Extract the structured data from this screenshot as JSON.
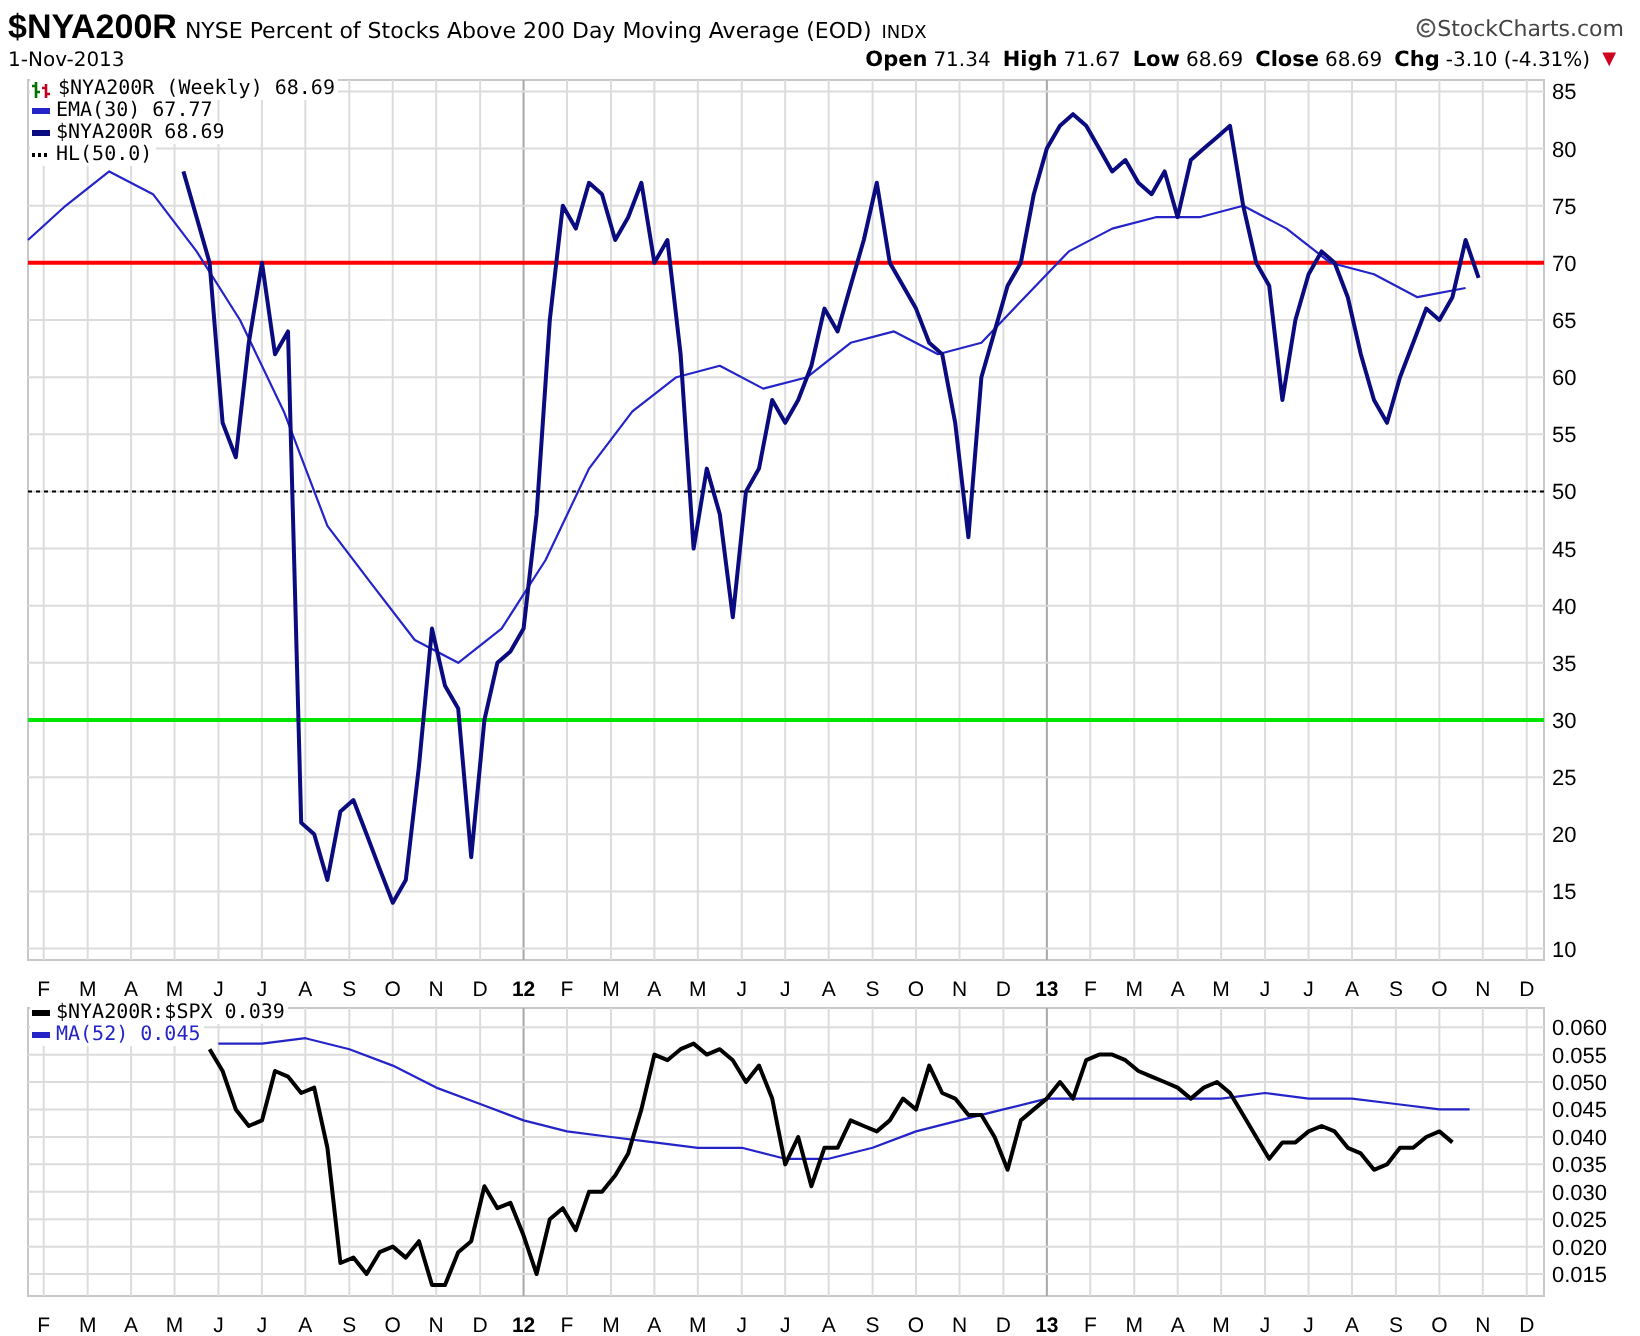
{
  "header": {
    "symbol": "$NYA200R",
    "title": "NYSE Percent of Stocks Above 200 Day Moving Average (EOD)",
    "exchange": "INDX",
    "brand": "StockCharts.com",
    "date": "1-Nov-2013",
    "quote": [
      {
        "label": "Open",
        "value": "71.34"
      },
      {
        "label": "High",
        "value": "71.67"
      },
      {
        "label": "Low",
        "value": "68.69"
      },
      {
        "label": "Close",
        "value": "68.69"
      },
      {
        "label": "Chg",
        "value": "-3.10 (-4.31%)"
      }
    ],
    "change_arrow": "▼"
  },
  "main_chart": {
    "legend": [
      {
        "kind": "bars",
        "text": "$NYA200R (Weekly) 68.69"
      },
      {
        "kind": "line",
        "text": "EMA(30) 67.77",
        "color": "#2424c8"
      },
      {
        "kind": "line",
        "text": "$NYA200R  68.69",
        "color": "#0b0b80"
      },
      {
        "kind": "dotted",
        "text": "HL(50.0)",
        "color": "#000000"
      }
    ],
    "chart_data": {
      "type": "line",
      "ylim": [
        9,
        86
      ],
      "xlim": [
        11.053,
        13.95
      ],
      "yticks": [
        10,
        15,
        20,
        25,
        30,
        35,
        40,
        45,
        50,
        55,
        60,
        65,
        70,
        75,
        80,
        85
      ],
      "xticks": [
        {
          "value": 11.083,
          "label": "F"
        },
        {
          "value": 11.167,
          "label": "M"
        },
        {
          "value": 11.25,
          "label": "A"
        },
        {
          "value": 11.333,
          "label": "M"
        },
        {
          "value": 11.417,
          "label": "J"
        },
        {
          "value": 11.5,
          "label": "J"
        },
        {
          "value": 11.583,
          "label": "A"
        },
        {
          "value": 11.667,
          "label": "S"
        },
        {
          "value": 11.75,
          "label": "O"
        },
        {
          "value": 11.833,
          "label": "N"
        },
        {
          "value": 11.917,
          "label": "D"
        },
        {
          "value": 12,
          "label": "12"
        },
        {
          "value": 12.083,
          "label": "F"
        },
        {
          "value": 12.167,
          "label": "M"
        },
        {
          "value": 12.25,
          "label": "A"
        },
        {
          "value": 12.333,
          "label": "M"
        },
        {
          "value": 12.417,
          "label": "J"
        },
        {
          "value": 12.5,
          "label": "J"
        },
        {
          "value": 12.583,
          "label": "A"
        },
        {
          "value": 12.667,
          "label": "S"
        },
        {
          "value": 12.75,
          "label": "O"
        },
        {
          "value": 12.833,
          "label": "N"
        },
        {
          "value": 12.917,
          "label": "D"
        },
        {
          "value": 13,
          "label": "13"
        },
        {
          "value": 13.083,
          "label": "F"
        },
        {
          "value": 13.167,
          "label": "M"
        },
        {
          "value": 13.25,
          "label": "A"
        },
        {
          "value": 13.333,
          "label": "M"
        },
        {
          "value": 13.417,
          "label": "J"
        },
        {
          "value": 13.5,
          "label": "J"
        },
        {
          "value": 13.583,
          "label": "A"
        },
        {
          "value": 13.667,
          "label": "S"
        },
        {
          "value": 13.75,
          "label": "O"
        },
        {
          "value": 13.833,
          "label": "N"
        },
        {
          "value": 13.917,
          "label": "D"
        }
      ],
      "series": [
        {
          "line_style": "solid",
          "color": "#ff0000",
          "x": [
            11.053,
            13.95
          ],
          "values": [
            70,
            70
          ]
        },
        {
          "line_style": "dotted",
          "color": "#000000",
          "x": [
            11.053,
            13.95
          ],
          "values": [
            50,
            50
          ]
        },
        {
          "line_style": "solid",
          "color": "#00e600",
          "x": [
            11.053,
            13.95
          ],
          "values": [
            30,
            30
          ]
        },
        {
          "line_style": "solid",
          "color": "#2424c8",
          "x": [
            11.053,
            11.125,
            11.208,
            11.292,
            11.375,
            11.458,
            11.542,
            11.625,
            11.708,
            11.792,
            11.875,
            11.958,
            12.042,
            12.125,
            12.208,
            12.292,
            12.375,
            12.458,
            12.542,
            12.625,
            12.708,
            12.792,
            12.875,
            12.958,
            13.042,
            13.125,
            13.208,
            13.292,
            13.375,
            13.458,
            13.542,
            13.625,
            13.708,
            13.8
          ],
          "values": [
            72,
            75,
            78,
            76,
            71,
            65,
            57,
            47,
            42,
            37,
            35,
            38,
            44,
            52,
            57,
            60,
            61,
            59,
            60,
            63,
            64,
            62,
            63,
            67,
            71,
            73,
            74,
            74,
            75,
            73,
            70,
            69,
            67,
            67.8
          ]
        },
        {
          "line_style": "solid",
          "color": "#0b0b80",
          "x": [
            11.35,
            11.375,
            11.4,
            11.425,
            11.45,
            11.475,
            11.5,
            11.525,
            11.55,
            11.575,
            11.6,
            11.625,
            11.65,
            11.675,
            11.7,
            11.725,
            11.75,
            11.775,
            11.8,
            11.825,
            11.85,
            11.875,
            11.9,
            11.925,
            11.95,
            11.975,
            12,
            12.025,
            12.05,
            12.075,
            12.1,
            12.125,
            12.15,
            12.175,
            12.2,
            12.225,
            12.25,
            12.275,
            12.3,
            12.325,
            12.35,
            12.375,
            12.4,
            12.425,
            12.45,
            12.475,
            12.5,
            12.525,
            12.55,
            12.575,
            12.6,
            12.625,
            12.65,
            12.675,
            12.7,
            12.725,
            12.75,
            12.775,
            12.8,
            12.825,
            12.85,
            12.875,
            12.9,
            12.925,
            12.95,
            12.975,
            13,
            13.025,
            13.05,
            13.075,
            13.1,
            13.125,
            13.15,
            13.175,
            13.2,
            13.225,
            13.25,
            13.275,
            13.3,
            13.325,
            13.35,
            13.375,
            13.4,
            13.425,
            13.45,
            13.475,
            13.5,
            13.525,
            13.55,
            13.575,
            13.6,
            13.625,
            13.65,
            13.675,
            13.7,
            13.725,
            13.75,
            13.775,
            13.8,
            13.825
          ],
          "values": [
            78,
            74,
            70,
            56,
            53,
            63,
            70,
            62,
            64,
            21,
            20,
            16,
            22,
            23,
            20,
            17,
            14,
            16,
            26,
            38,
            33,
            31,
            18,
            30,
            35,
            36,
            38,
            48,
            65,
            75,
            73,
            77,
            76,
            72,
            74,
            77,
            70,
            72,
            62,
            45,
            52,
            48,
            39,
            50,
            52,
            58,
            56,
            58,
            61,
            66,
            64,
            68,
            72,
            77,
            70,
            68,
            66,
            63,
            62,
            56,
            46,
            60,
            64,
            68,
            70,
            76,
            80,
            82,
            83,
            82,
            80,
            78,
            79,
            77,
            76,
            78,
            74,
            79,
            80,
            81,
            82,
            75,
            70,
            68,
            58,
            65,
            69,
            71,
            70,
            67,
            62,
            58,
            56,
            60,
            63,
            66,
            65,
            67,
            72,
            68.7
          ]
        }
      ],
      "grid": true
    }
  },
  "ratio_chart": {
    "legend": [
      {
        "kind": "line",
        "text": "$NYA200R:$SPX  0.039",
        "color": "#000000"
      },
      {
        "kind": "line",
        "text": "MA(52) 0.045",
        "color": "#2424c8"
      }
    ],
    "chart_data": {
      "type": "line",
      "ylim": [
        0.011,
        0.0635
      ],
      "xlim": [
        11.053,
        13.95
      ],
      "grid": true,
      "yticks": [
        {
          "value": 0.015,
          "label": "0.015"
        },
        {
          "value": 0.02,
          "label": "0.020"
        },
        {
          "value": 0.025,
          "label": "0.025"
        },
        {
          "value": 0.03,
          "label": "0.030"
        },
        {
          "value": 0.035,
          "label": "0.035"
        },
        {
          "value": 0.04,
          "label": "0.040"
        },
        {
          "value": 0.045,
          "label": "0.045"
        },
        {
          "value": 0.05,
          "label": "0.050"
        },
        {
          "value": 0.055,
          "label": "0.055"
        },
        {
          "value": 0.06,
          "label": "0.060"
        }
      ],
      "xticks": [
        {
          "value": 11.083,
          "label": "F"
        },
        {
          "value": 11.167,
          "label": "M"
        },
        {
          "value": 11.25,
          "label": "A"
        },
        {
          "value": 11.333,
          "label": "M"
        },
        {
          "value": 11.417,
          "label": "J"
        },
        {
          "value": 11.5,
          "label": "J"
        },
        {
          "value": 11.583,
          "label": "A"
        },
        {
          "value": 11.667,
          "label": "S"
        },
        {
          "value": 11.75,
          "label": "O"
        },
        {
          "value": 11.833,
          "label": "N"
        },
        {
          "value": 11.917,
          "label": "D"
        },
        {
          "value": 12,
          "label": "12"
        },
        {
          "value": 12.083,
          "label": "F"
        },
        {
          "value": 12.167,
          "label": "M"
        },
        {
          "value": 12.25,
          "label": "A"
        },
        {
          "value": 12.333,
          "label": "M"
        },
        {
          "value": 12.417,
          "label": "J"
        },
        {
          "value": 12.5,
          "label": "J"
        },
        {
          "value": 12.583,
          "label": "A"
        },
        {
          "value": 12.667,
          "label": "S"
        },
        {
          "value": 12.75,
          "label": "O"
        },
        {
          "value": 12.833,
          "label": "N"
        },
        {
          "value": 12.917,
          "label": "D"
        },
        {
          "value": 13,
          "label": "13"
        },
        {
          "value": 13.083,
          "label": "F"
        },
        {
          "value": 13.167,
          "label": "M"
        },
        {
          "value": 13.25,
          "label": "A"
        },
        {
          "value": 13.333,
          "label": "M"
        },
        {
          "value": 13.417,
          "label": "J"
        },
        {
          "value": 13.5,
          "label": "J"
        },
        {
          "value": 13.583,
          "label": "A"
        },
        {
          "value": 13.667,
          "label": "S"
        },
        {
          "value": 13.75,
          "label": "O"
        },
        {
          "value": 13.833,
          "label": "N"
        },
        {
          "value": 13.917,
          "label": "D"
        }
      ],
      "series": [
        {
          "line_style": "solid",
          "color": "#2424c8",
          "x": [
            11.417,
            11.5,
            11.583,
            11.667,
            11.75,
            11.833,
            11.917,
            12,
            12.083,
            12.167,
            12.25,
            12.333,
            12.417,
            12.5,
            12.583,
            12.667,
            12.75,
            12.833,
            12.917,
            13,
            13.083,
            13.167,
            13.25,
            13.333,
            13.417,
            13.5,
            13.583,
            13.667,
            13.75,
            13.808
          ],
          "values": [
            0.057,
            0.057,
            0.058,
            0.056,
            0.053,
            0.049,
            0.046,
            0.043,
            0.041,
            0.04,
            0.039,
            0.038,
            0.038,
            0.036,
            0.036,
            0.038,
            0.041,
            0.043,
            0.045,
            0.047,
            0.047,
            0.047,
            0.047,
            0.047,
            0.048,
            0.047,
            0.047,
            0.046,
            0.045,
            0.045
          ]
        },
        {
          "line_style": "solid",
          "color": "#000000",
          "x": [
            11.4,
            11.425,
            11.45,
            11.475,
            11.5,
            11.525,
            11.55,
            11.575,
            11.6,
            11.625,
            11.65,
            11.675,
            11.7,
            11.725,
            11.75,
            11.775,
            11.8,
            11.825,
            11.85,
            11.875,
            11.9,
            11.925,
            11.95,
            11.975,
            12,
            12.025,
            12.05,
            12.075,
            12.1,
            12.125,
            12.15,
            12.175,
            12.2,
            12.225,
            12.25,
            12.275,
            12.3,
            12.325,
            12.35,
            12.375,
            12.4,
            12.425,
            12.45,
            12.475,
            12.5,
            12.525,
            12.55,
            12.575,
            12.6,
            12.625,
            12.65,
            12.675,
            12.7,
            12.725,
            12.75,
            12.775,
            12.8,
            12.825,
            12.85,
            12.875,
            12.9,
            12.925,
            12.95,
            12.975,
            13,
            13.025,
            13.05,
            13.075,
            13.1,
            13.125,
            13.15,
            13.175,
            13.2,
            13.225,
            13.25,
            13.275,
            13.3,
            13.325,
            13.35,
            13.375,
            13.4,
            13.425,
            13.45,
            13.475,
            13.5,
            13.525,
            13.55,
            13.575,
            13.6,
            13.625,
            13.65,
            13.675,
            13.7,
            13.725,
            13.75,
            13.775
          ],
          "values": [
            0.056,
            0.052,
            0.045,
            0.042,
            0.043,
            0.052,
            0.051,
            0.048,
            0.049,
            0.038,
            0.017,
            0.018,
            0.015,
            0.019,
            0.02,
            0.018,
            0.021,
            0.013,
            0.013,
            0.019,
            0.021,
            0.031,
            0.027,
            0.028,
            0.022,
            0.015,
            0.025,
            0.027,
            0.023,
            0.03,
            0.03,
            0.033,
            0.037,
            0.045,
            0.055,
            0.054,
            0.056,
            0.057,
            0.055,
            0.056,
            0.054,
            0.05,
            0.053,
            0.047,
            0.035,
            0.04,
            0.031,
            0.038,
            0.038,
            0.043,
            0.042,
            0.041,
            0.043,
            0.047,
            0.045,
            0.053,
            0.048,
            0.047,
            0.044,
            0.044,
            0.04,
            0.034,
            0.043,
            0.045,
            0.047,
            0.05,
            0.047,
            0.054,
            0.055,
            0.055,
            0.054,
            0.052,
            0.051,
            0.05,
            0.049,
            0.047,
            0.049,
            0.05,
            0.048,
            0.044,
            0.04,
            0.036,
            0.039,
            0.039,
            0.041,
            0.042,
            0.041,
            0.038,
            0.037,
            0.034,
            0.035,
            0.038,
            0.038,
            0.04,
            0.041,
            0.039
          ]
        }
      ]
    }
  }
}
